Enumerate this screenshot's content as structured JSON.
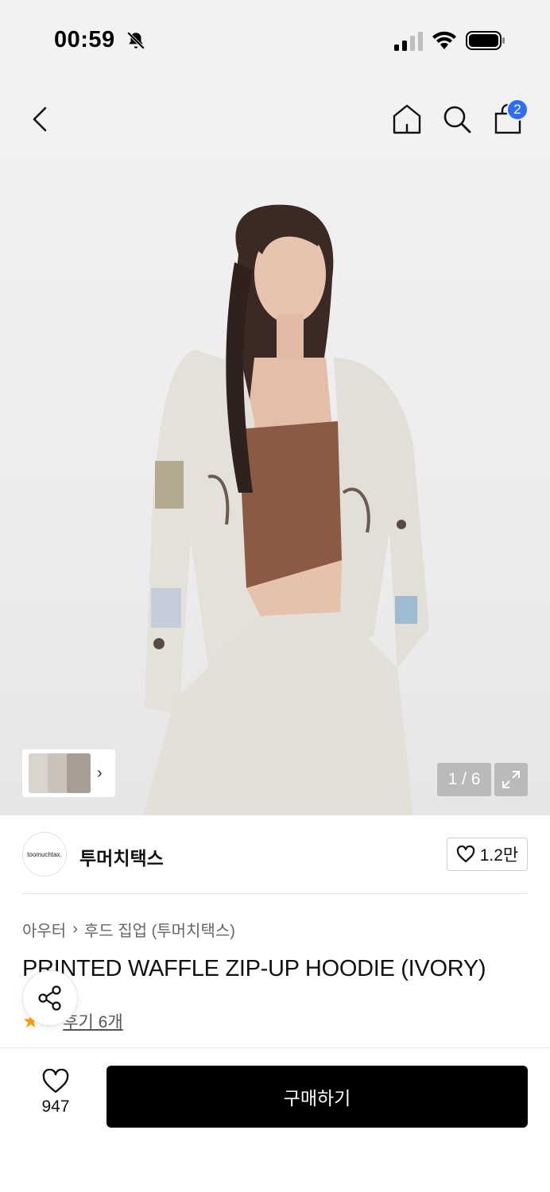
{
  "status_bar": {
    "time": "00:59"
  },
  "header": {
    "cart_count": "2"
  },
  "gallery": {
    "counter": "1 / 6"
  },
  "brand": {
    "logo_text": "toomuchtax.",
    "name": "투머치택스",
    "likes": "1.2만"
  },
  "breadcrumb": {
    "category": "아우터",
    "subcategory": "후드 집업 (투머치택스)"
  },
  "product": {
    "title": "PRINTED WAFFLE ZIP-UP HOODIE (IVORY)",
    "rating": "5",
    "review_label": "후기 6개"
  },
  "bottom_bar": {
    "wish_count": "947",
    "buy_label": "구매하기"
  },
  "colors": {
    "accent": "#2f6bff",
    "star": "#ff9d00",
    "buy_bg": "#000000"
  }
}
